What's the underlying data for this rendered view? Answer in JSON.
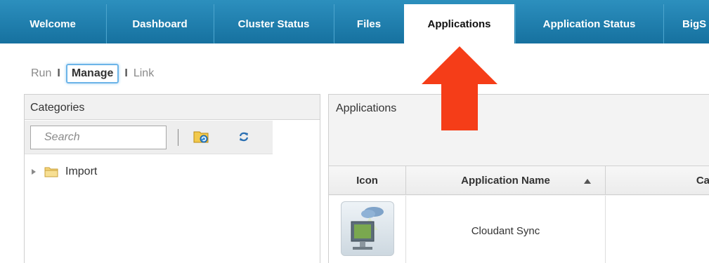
{
  "nav": {
    "tabs": [
      {
        "label": "Welcome",
        "active": false
      },
      {
        "label": "Dashboard",
        "active": false
      },
      {
        "label": "Cluster Status",
        "active": false
      },
      {
        "label": "Files",
        "active": false
      },
      {
        "label": "Applications",
        "active": true
      },
      {
        "label": "Application Status",
        "active": false
      },
      {
        "label": "BigS",
        "active": false
      }
    ]
  },
  "subnav": {
    "run_label": "Run",
    "manage_label": "Manage",
    "link_label": "Link",
    "separator": "I"
  },
  "categories": {
    "title": "Categories",
    "search_placeholder": "Search",
    "tree": [
      {
        "label": "Import",
        "expanded": false
      }
    ]
  },
  "applications": {
    "title": "Applications",
    "columns": [
      "Icon",
      "Application Name",
      "Ca"
    ],
    "sort_column": "Application Name",
    "sort_direction": "ascending",
    "rows": [
      {
        "icon": "cloudant-sync-app-icon",
        "name": "Cloudant Sync"
      }
    ]
  },
  "colors": {
    "tab_bar": "#1f82b3",
    "tab_active": "#ffffff",
    "annotation_arrow": "#f53d18",
    "focus_ring": "#6cb4e8"
  },
  "icons": {
    "folder_refresh": "folder-refresh-icon",
    "refresh": "refresh-icon",
    "folder": "folder-icon",
    "tree_arrow": "tree-expand-arrow-icon",
    "sort": "sort-asc-icon"
  }
}
